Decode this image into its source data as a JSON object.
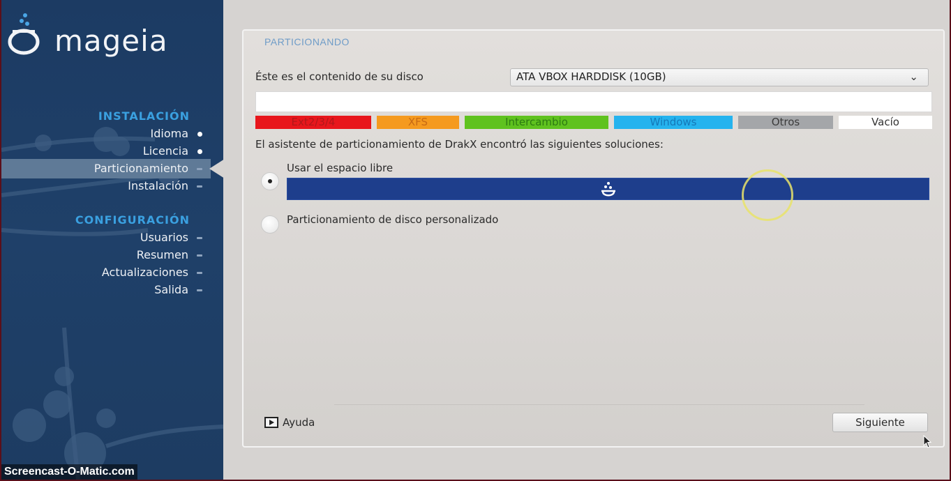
{
  "brand": {
    "logo_text": "mageia"
  },
  "sidebar": {
    "sections": [
      {
        "title": "INSTALACIÓN",
        "items": [
          {
            "label": "Idioma",
            "state": "done"
          },
          {
            "label": "Licencia",
            "state": "done"
          },
          {
            "label": "Particionamiento",
            "state": "active"
          },
          {
            "label": "Instalación",
            "state": "pending"
          }
        ]
      },
      {
        "title": "CONFIGURACIÓN",
        "items": [
          {
            "label": "Usuarios",
            "state": "pending"
          },
          {
            "label": "Resumen",
            "state": "pending"
          },
          {
            "label": "Actualizaciones",
            "state": "pending"
          },
          {
            "label": "Salida",
            "state": "pending"
          }
        ]
      }
    ]
  },
  "panel": {
    "title": "PARTICIONANDO",
    "disk_label": "Éste es el contenido de su disco",
    "disk_selected": "ATA VBOX HARDDISK (10GB)",
    "legend": [
      {
        "label": "Ext2/3/4",
        "bg": "#e8161c",
        "fg": "#b0181a"
      },
      {
        "label": "XFS",
        "bg": "#f59a1f",
        "fg": "#c76a14"
      },
      {
        "label": "Intercambio",
        "bg": "#5fc21f",
        "fg": "#2c7a12"
      },
      {
        "label": "Windows",
        "bg": "#25b3ee",
        "fg": "#1678b8"
      },
      {
        "label": "Otros",
        "bg": "#a4a6a9",
        "fg": "#3b3b3b"
      },
      {
        "label": "Vacío",
        "bg": "#ffffff",
        "fg": "#333333"
      }
    ],
    "solutions_text": "El asistente de particionamiento de DrakX encontró las siguientes soluciones:",
    "options": [
      {
        "label": "Usar el espacio libre",
        "selected": true
      },
      {
        "label": "Particionamiento de disco personalizado",
        "selected": false
      }
    ],
    "help_label": "Ayuda",
    "next_label": "Siguiente"
  },
  "watermark": "Screencast-O-Matic.com",
  "colors": {
    "sidebar_bg": "#1f4069",
    "section_title": "#3aa0e0",
    "free_space_bar": "#1e3e8c",
    "panel_title": "#6f9cc8"
  }
}
